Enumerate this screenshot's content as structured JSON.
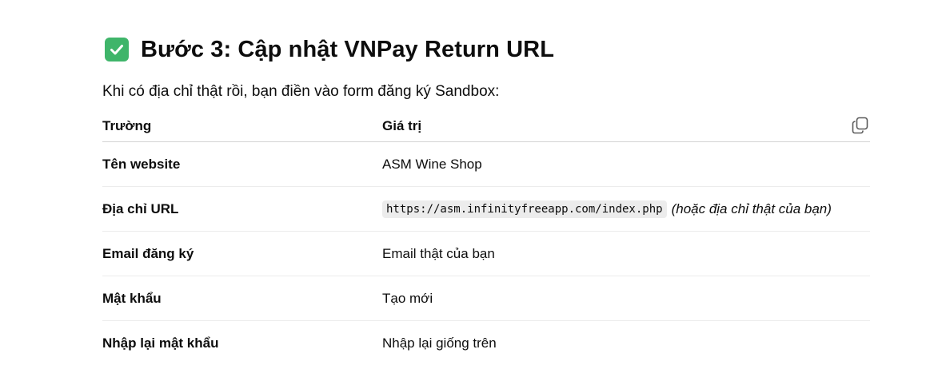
{
  "section": {
    "heading": "Bước 3: Cập nhật VNPay Return URL",
    "heading_icon": "check-mark-button-icon",
    "intro": "Khi có địa chỉ thật rồi, bạn điền vào form đăng ký Sandbox:"
  },
  "table": {
    "headers": [
      "Trường",
      "Giá trị"
    ],
    "copy_icon": "copy-icon",
    "rows": [
      {
        "field": "Tên website",
        "value": "ASM Wine Shop"
      },
      {
        "field": "Địa chỉ URL",
        "code": "https://asm.infinityfreeapp.com/index.php",
        "note": "(hoặc địa chỉ thật của bạn)"
      },
      {
        "field": "Email đăng ký",
        "value": "Email thật của bạn"
      },
      {
        "field": "Mật khẩu",
        "value": "Tạo mới"
      },
      {
        "field": "Nhập lại mật khẩu",
        "value": "Nhập lại giống trên"
      }
    ]
  },
  "colors": {
    "check_badge": "#3fb56a",
    "text": "#0d0d0d",
    "code_bg": "#ececec"
  }
}
